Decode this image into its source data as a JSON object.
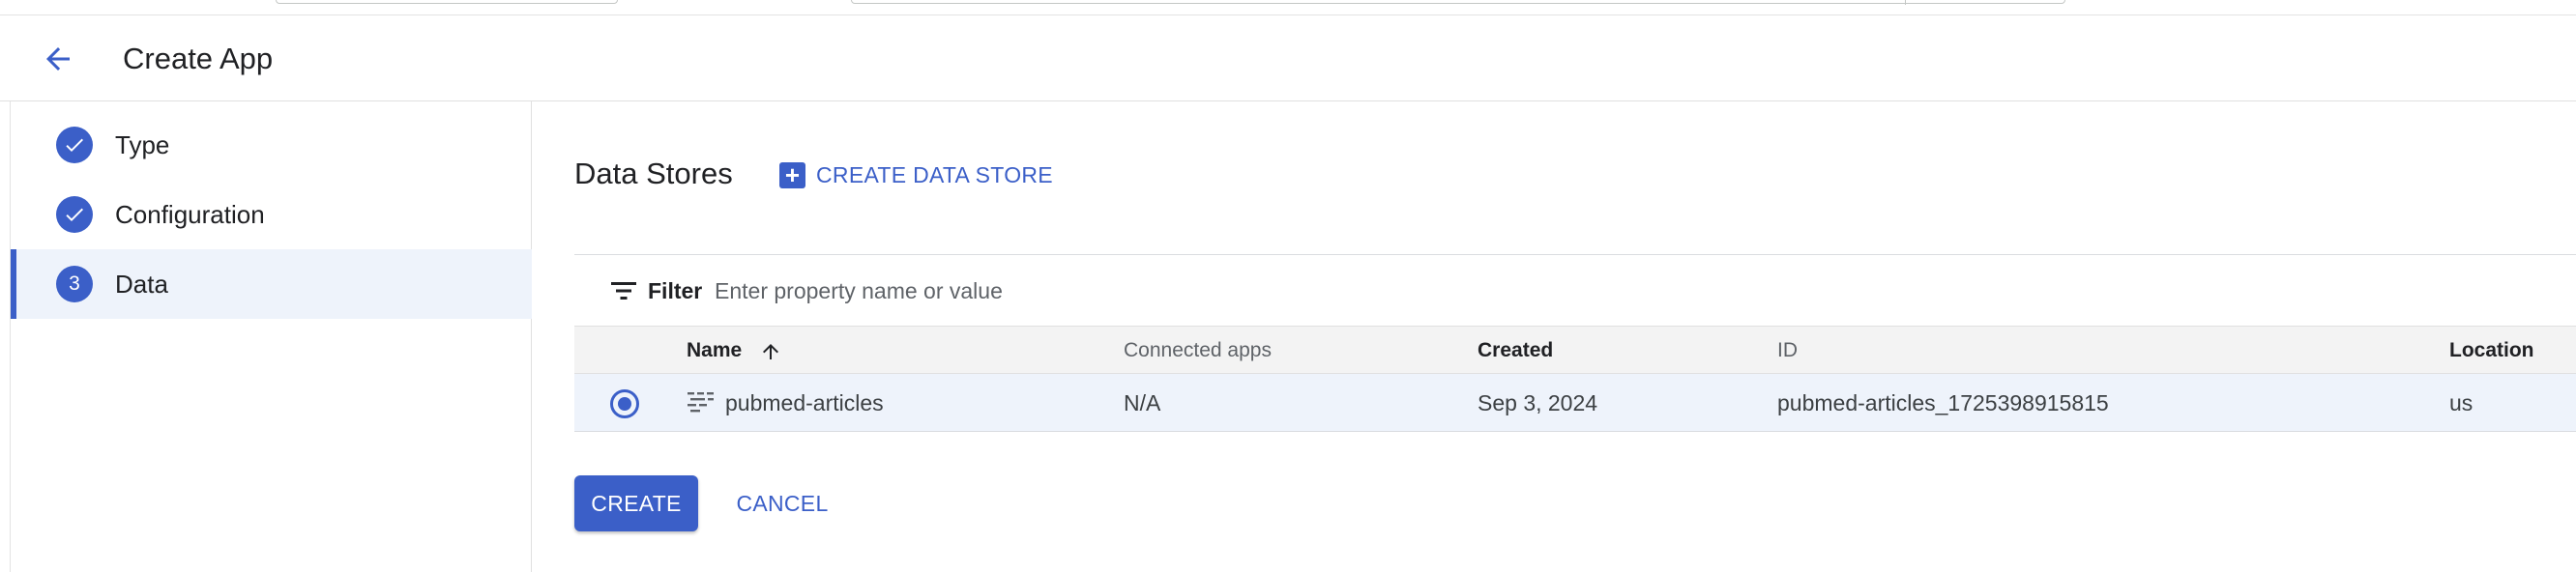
{
  "header": {
    "title": "Create App",
    "back_icon": "arrow-back-icon"
  },
  "stepper": {
    "steps": [
      {
        "label": "Type",
        "state": "completed",
        "indicator": "check-icon"
      },
      {
        "label": "Configuration",
        "state": "completed",
        "indicator": "check-icon"
      },
      {
        "label": "Data",
        "state": "active",
        "number": "3"
      }
    ]
  },
  "main": {
    "section_title": "Data Stores",
    "create_data_store_label": "CREATE DATA STORE",
    "filter": {
      "label": "Filter",
      "placeholder": "Enter property name or value"
    },
    "table": {
      "columns": {
        "name": "Name",
        "connected_apps": "Connected apps",
        "created": "Created",
        "id": "ID",
        "location": "Location"
      },
      "sort": {
        "column": "name",
        "direction": "ascending"
      },
      "rows": [
        {
          "selected": true,
          "name": "pubmed-articles",
          "connected_apps": "N/A",
          "created": "Sep 3, 2024",
          "id": "pubmed-articles_1725398915815",
          "location": "us"
        }
      ]
    },
    "actions": {
      "create_label": "CREATE",
      "cancel_label": "CANCEL"
    }
  },
  "colors": {
    "accent": "#3b5fc8",
    "selected_row": "#eef3fb",
    "header_row": "#f3f3f3"
  }
}
